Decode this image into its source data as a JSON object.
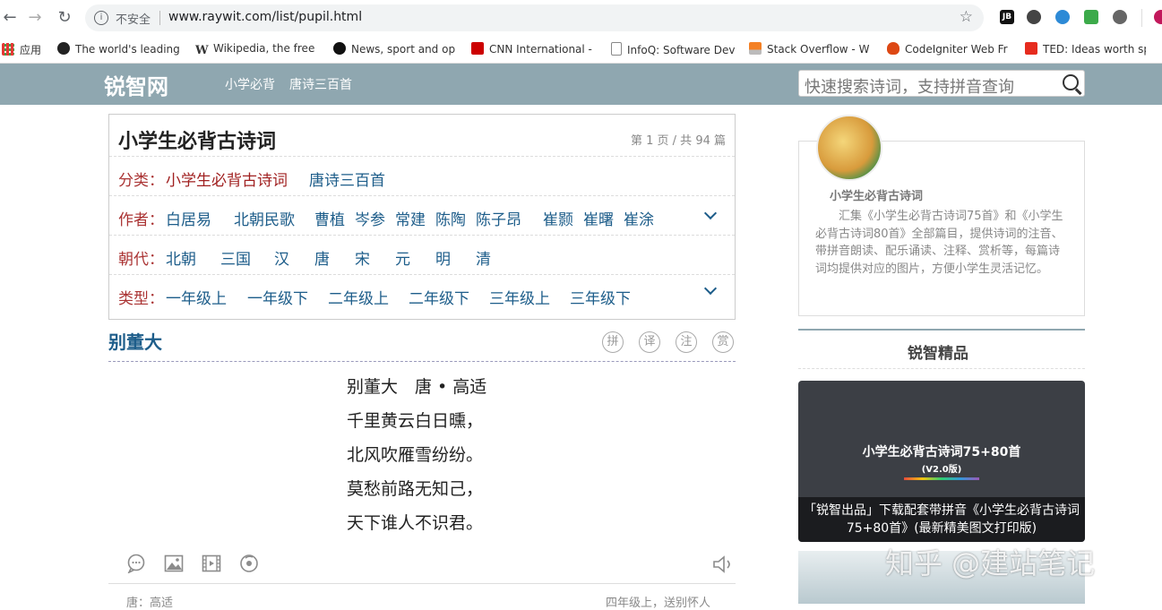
{
  "browser": {
    "insecure_label": "不安全",
    "url": "www.raywit.com/list/pupil.html",
    "apps_label": "应用",
    "bookmarks": [
      "The world's leading",
      "Wikipedia, the free",
      "News, sport and op",
      "CNN International -",
      "InfoQ: Software Dev",
      "Stack Overflow - W",
      "CodeIgniter Web Fr",
      "TED: Ideas worth sp"
    ],
    "ext_jb": "JB"
  },
  "site": {
    "logo": "锐智网",
    "nav": [
      "小学必背",
      "唐诗三百首"
    ],
    "search_placeholder": "快速搜索诗词，支持拼音查询"
  },
  "filter": {
    "title": "小学生必背古诗词",
    "page_info": "第 1 页 / 共 94 篇",
    "rows": [
      {
        "label": "分类：",
        "items": [
          "小学生必背古诗词",
          "唐诗三百首"
        ]
      },
      {
        "label": "作者：",
        "items": [
          "白居易",
          "北朝民歌",
          "曹植",
          "岑参",
          "常建",
          "陈陶",
          "陈子昂",
          "崔颢",
          "崔曙",
          "崔涂"
        ]
      },
      {
        "label": "朝代：",
        "items": [
          "北朝",
          "三国",
          "汉",
          "唐",
          "宋",
          "元",
          "明",
          "清"
        ]
      },
      {
        "label": "类型：",
        "items": [
          "一年级上",
          "一年级下",
          "二年级上",
          "二年级下",
          "三年级上",
          "三年级下"
        ]
      }
    ]
  },
  "poem": {
    "title": "别董大",
    "controls": [
      "拼",
      "译",
      "注",
      "赏"
    ],
    "lines": [
      "别董大　唐 • 高适",
      "千里黄云白日曛，",
      "北风吹雁雪纷纷。",
      "莫愁前路无知己，",
      "天下谁人不识君。"
    ],
    "footer_left": "唐：高适",
    "footer_right": "四年级上，送别怀人"
  },
  "sidebar": {
    "name": "小学生必背古诗词",
    "desc": "汇集《小学生必背古诗词75首》和《小学生必背古诗词80首》全部篇目，提供诗词的注音、带拼音朗读、配乐诵读、注释、赏析等，每篇诗词均提供对应的图片，方便小学生灵活记忆。",
    "picks_title": "锐智精品",
    "banner_title": "小学生必背古诗词75+80首",
    "banner_sub": "(V2.0版)",
    "banner_caption": "「锐智出品」下载配套带拼音《小学生必背古诗词75+80首》(最新精美图文打印版)",
    "watermark": "知乎 @建站笔记"
  }
}
